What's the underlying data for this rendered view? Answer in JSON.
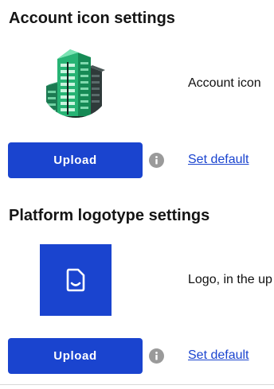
{
  "account_icon_section": {
    "title": "Account icon settings",
    "description": "Account icon",
    "upload_label": "Upload",
    "set_default_label": "Set default",
    "preview_icon": "building-icon",
    "info_icon": "info-icon"
  },
  "platform_logo_section": {
    "title": "Platform logotype settings",
    "description": "Logo, in the up",
    "upload_label": "Upload",
    "set_default_label": "Set default",
    "preview_icon": "document-smile-icon",
    "info_icon": "info-icon"
  },
  "colors": {
    "accent": "#1a44cf",
    "building_green": "#1fa36a",
    "info_gray": "#9a9a9a"
  }
}
